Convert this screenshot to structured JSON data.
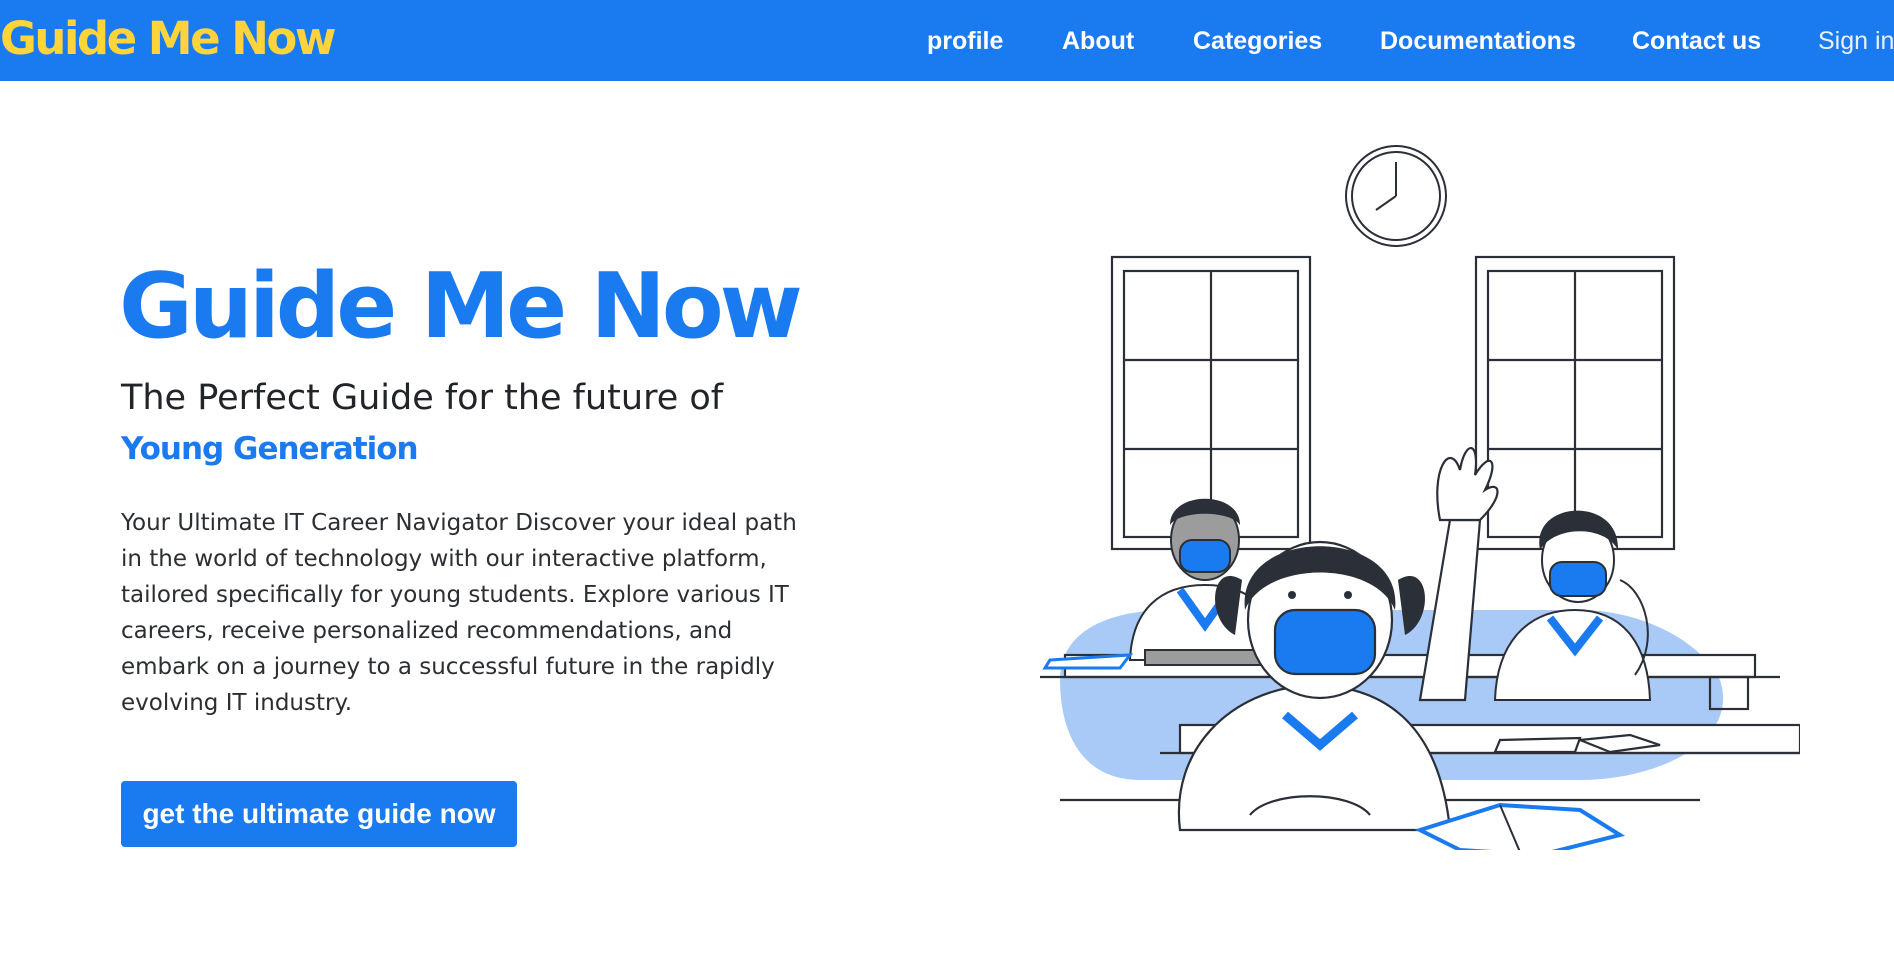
{
  "nav": {
    "brand": "Guide Me Now",
    "links": [
      "profile",
      "About",
      "Categories",
      "Documentations",
      "Contact us",
      "Sign in"
    ]
  },
  "hero": {
    "title": "Guide Me Now",
    "subtitle": "The Perfect Guide for the future of",
    "highlight": "Young Generation",
    "description": "Your Ultimate IT Career Navigator Discover your ideal path in the world of technology with our interactive platform, tailored specifically for young students. Explore various IT careers, receive personalized recommendations, and embark on a journey to a successful future in the rapidly evolving IT industry.",
    "cta_label": "get the ultimate guide now"
  },
  "colors": {
    "brand_blue": "#1a7af0",
    "brand_yellow": "#ffd43b",
    "illustration_light_blue": "#a9c9f7"
  },
  "illustration": {
    "icon": "classroom-illustration"
  }
}
